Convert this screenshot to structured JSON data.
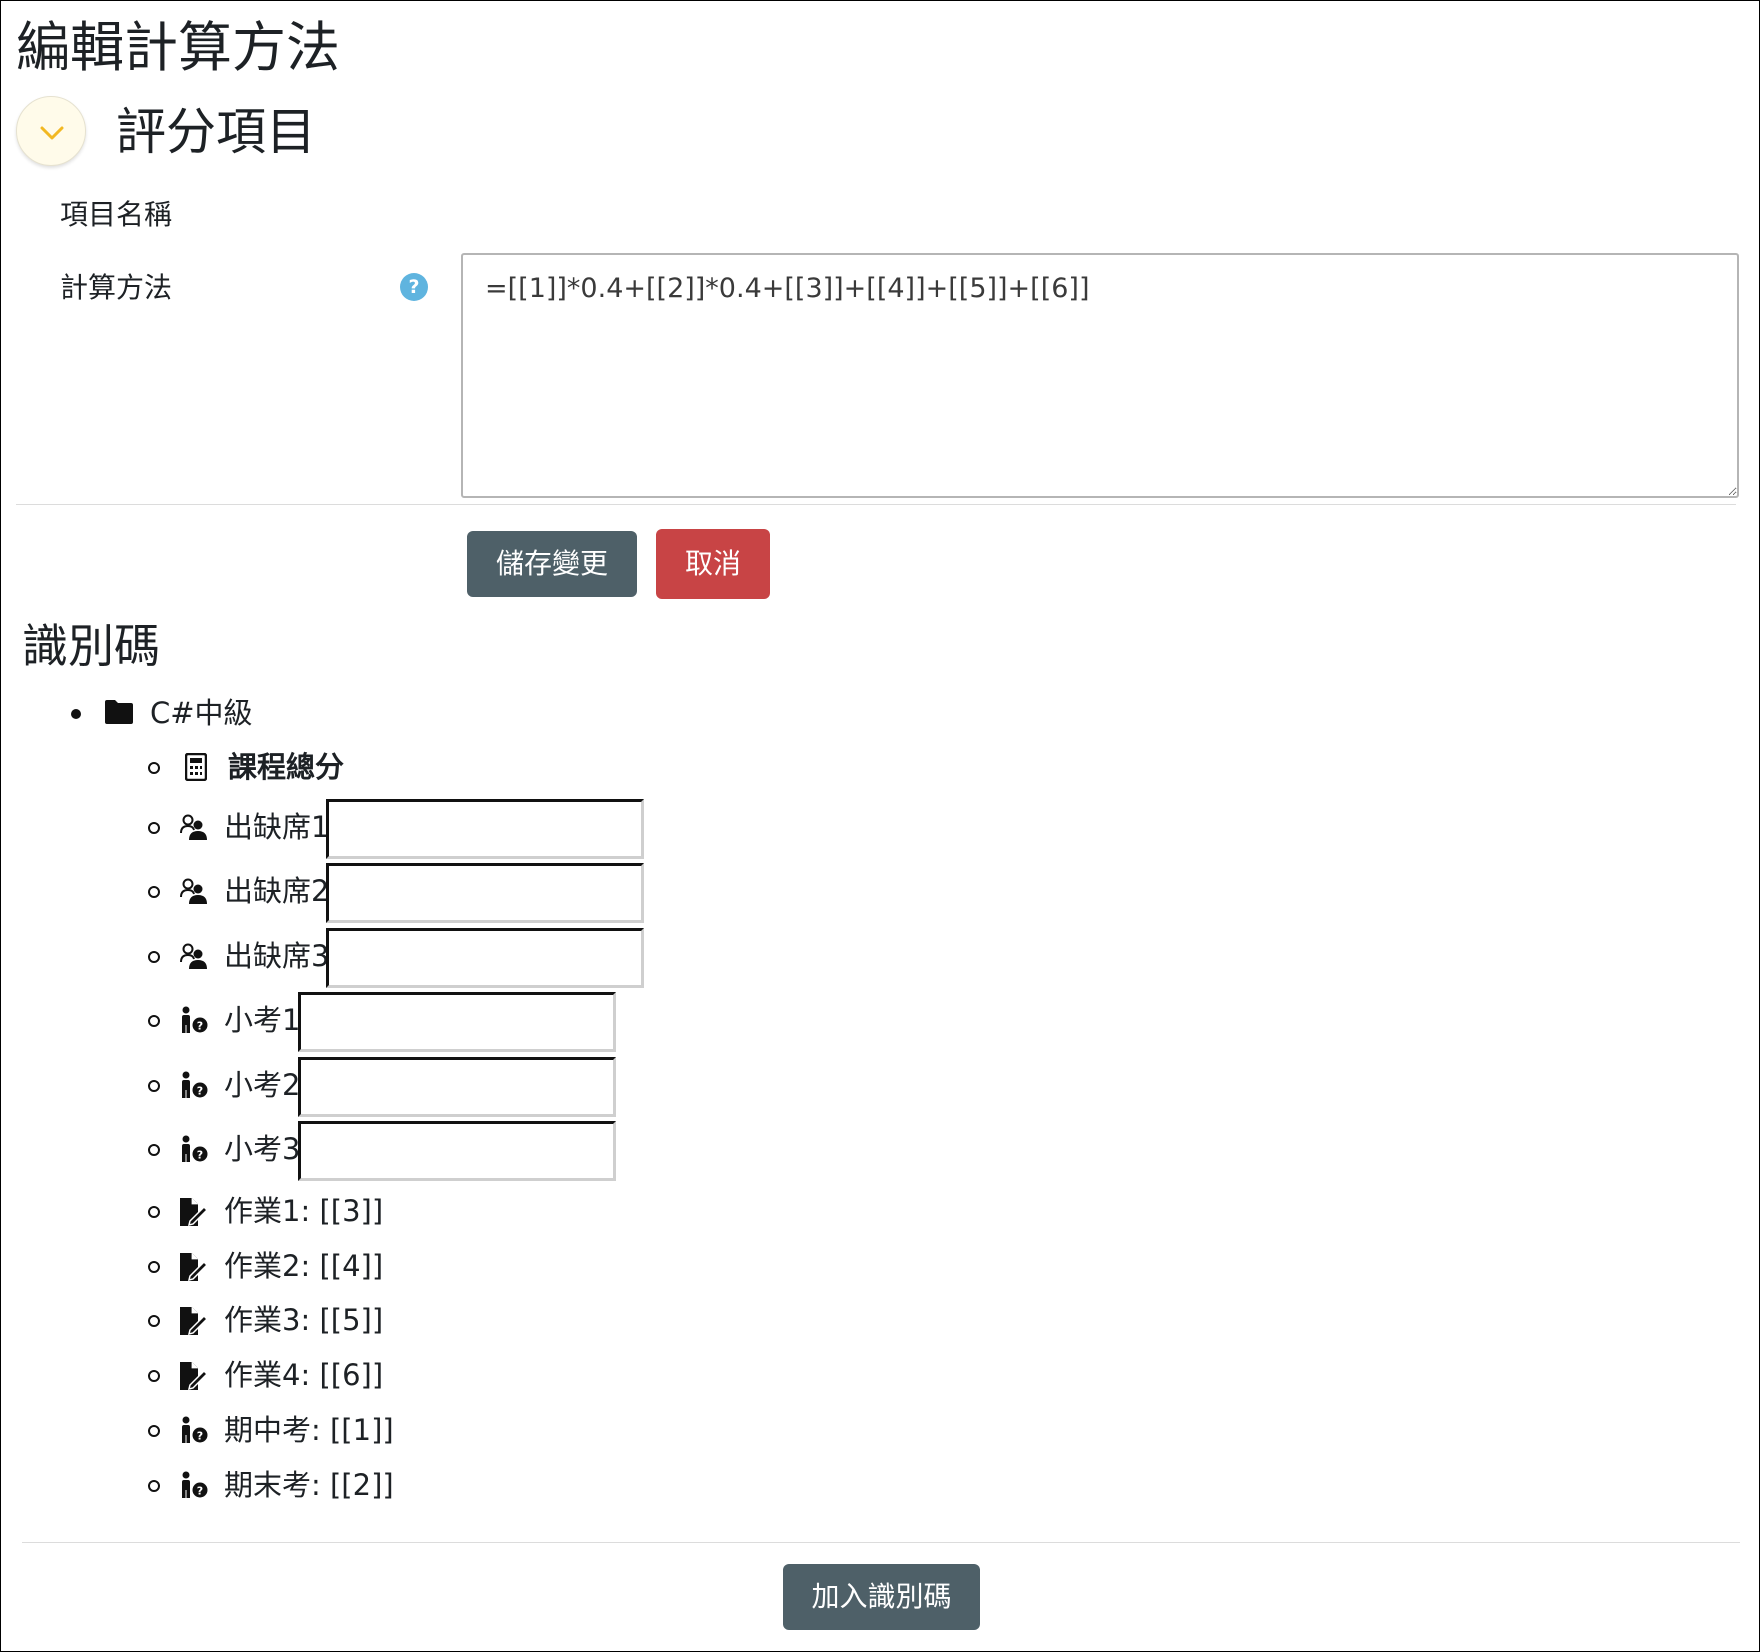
{
  "page": {
    "title": "編輯計算方法"
  },
  "section": {
    "title": "評分項目",
    "toggle_icon": "chevron-down-icon"
  },
  "form": {
    "item_name_label": "項目名稱",
    "calc_label": "計算方法",
    "calc_value": "=[[1]]*0.4+[[2]]*0.4+[[3]]+[[4]]+[[5]]+[[6]]",
    "help_icon": "question-circle-icon",
    "save_label": "儲存變更",
    "cancel_label": "取消"
  },
  "id_section": {
    "title": "識別碼",
    "course": {
      "label": "C#中級",
      "icon": "folder-icon"
    },
    "items": [
      {
        "label": "課程總分",
        "icon": "calculator-icon",
        "bold": true,
        "has_input": false,
        "input_value": ""
      },
      {
        "label": "出缺席1",
        "icon": "attendance-icon",
        "bold": false,
        "has_input": true,
        "input_value": ""
      },
      {
        "label": "出缺席2",
        "icon": "attendance-icon",
        "bold": false,
        "has_input": true,
        "input_value": ""
      },
      {
        "label": "出缺席3",
        "icon": "attendance-icon",
        "bold": false,
        "has_input": true,
        "input_value": ""
      },
      {
        "label": "小考1",
        "icon": "quiz-icon",
        "bold": false,
        "has_input": true,
        "input_value": ""
      },
      {
        "label": "小考2",
        "icon": "quiz-icon",
        "bold": false,
        "has_input": true,
        "input_value": ""
      },
      {
        "label": "小考3",
        "icon": "quiz-icon",
        "bold": false,
        "has_input": true,
        "input_value": ""
      },
      {
        "label": "作業1: [[3]]",
        "icon": "assignment-icon",
        "bold": false,
        "has_input": false,
        "input_value": ""
      },
      {
        "label": "作業2: [[4]]",
        "icon": "assignment-icon",
        "bold": false,
        "has_input": false,
        "input_value": ""
      },
      {
        "label": "作業3: [[5]]",
        "icon": "assignment-icon",
        "bold": false,
        "has_input": false,
        "input_value": ""
      },
      {
        "label": "作業4: [[6]]",
        "icon": "assignment-icon",
        "bold": false,
        "has_input": false,
        "input_value": ""
      },
      {
        "label": "期中考: [[1]]",
        "icon": "quiz-icon",
        "bold": false,
        "has_input": false,
        "input_value": ""
      },
      {
        "label": "期末考: [[2]]",
        "icon": "quiz-icon",
        "bold": false,
        "has_input": false,
        "input_value": ""
      }
    ],
    "add_label": "加入識別碼"
  },
  "colors": {
    "primary_button": "#4e6068",
    "danger_button": "#c84445",
    "help_icon": "#5fb4df",
    "toggle_background": "#fffbea",
    "toggle_chevron": "#f2b822"
  }
}
